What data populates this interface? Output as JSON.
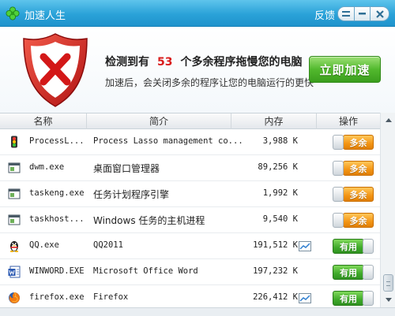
{
  "window": {
    "title": "加速人生",
    "feedback_label": "反馈"
  },
  "header": {
    "warning_prefix": "检测到有",
    "warning_count": "53",
    "warning_suffix": "个多余程序拖慢您的电脑",
    "subtitle": "加速后，会关闭多余的程序让您的电脑运行的更快",
    "accelerate_button": "立即加速"
  },
  "table": {
    "columns": [
      "名称",
      "简介",
      "内存",
      "操作"
    ],
    "rows": [
      {
        "icon": "traffic-light-icon",
        "name": "ProcessL...",
        "description": "Process Lasso management co...",
        "memory": "3,988 K",
        "chart": false,
        "action": "多余",
        "state": "off"
      },
      {
        "icon": "window-app-icon",
        "name": "dwm.exe",
        "description": "桌面窗口管理器",
        "memory": "89,256 K",
        "chart": false,
        "action": "多余",
        "state": "off"
      },
      {
        "icon": "window-app-icon",
        "name": "taskeng.exe",
        "description": "任务计划程序引擎",
        "memory": "1,992 K",
        "chart": false,
        "action": "多余",
        "state": "off"
      },
      {
        "icon": "window-app-icon",
        "name": "taskhost...",
        "description": "Windows 任务的主机进程",
        "memory": "9,540 K",
        "chart": false,
        "action": "多余",
        "state": "off"
      },
      {
        "icon": "qq-penguin-icon",
        "name": "QQ.exe",
        "description": "QQ2011",
        "memory": "191,512 K",
        "chart": true,
        "action": "有用",
        "state": "on"
      },
      {
        "icon": "word-document-icon",
        "name": "WINWORD.EXE",
        "description": "Microsoft Office Word",
        "memory": "197,232 K",
        "chart": false,
        "action": "有用",
        "state": "on"
      },
      {
        "icon": "firefox-icon",
        "name": "firefox.exe",
        "description": "Firefox",
        "memory": "226,412 K",
        "chart": true,
        "action": "有用",
        "state": "on"
      }
    ]
  },
  "colors": {
    "titlebar": "#2aa2d8",
    "warning_count": "#d91b1b",
    "accelerate": "#52b92e",
    "toggle_off": "#f39514",
    "toggle_on": "#3fa92a"
  }
}
